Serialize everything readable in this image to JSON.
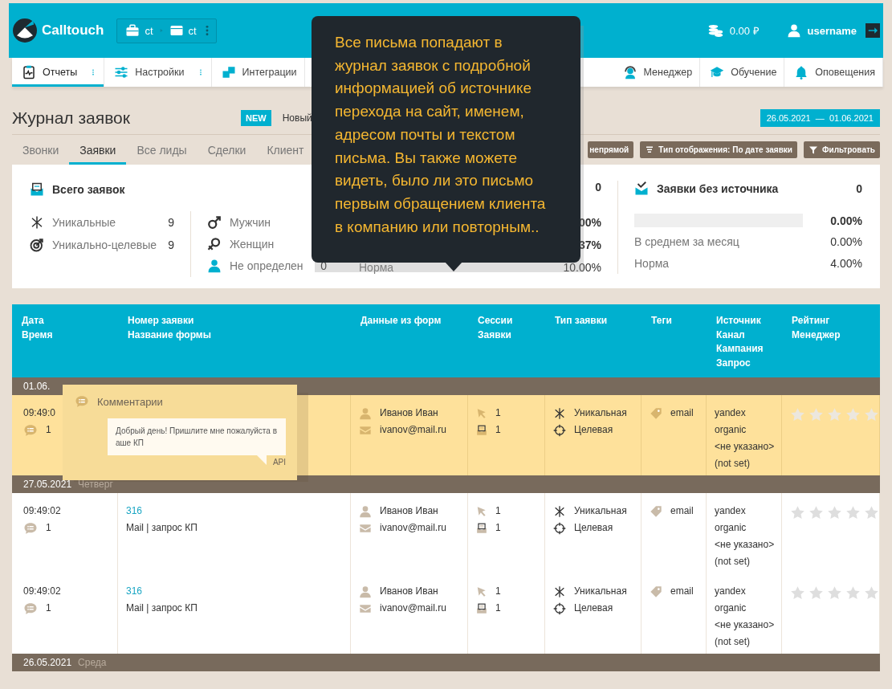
{
  "header": {
    "brand": "Calltouch",
    "breadcrumb": [
      "ct",
      "ct"
    ],
    "balance": "0.00 ₽",
    "user": "username"
  },
  "nav": [
    {
      "kind": "reports",
      "label": "Отчеты",
      "selected": true,
      "menu": true
    },
    {
      "kind": "settings",
      "label": "Настройки",
      "selected": false,
      "menu": true
    },
    {
      "kind": "integrations",
      "label": "Интеграции",
      "selected": false,
      "menu": false
    },
    {
      "kind": "manager",
      "label": "Менеджер",
      "selected": false,
      "menu": false
    },
    {
      "kind": "learning",
      "label": "Обучение",
      "selected": false,
      "menu": false
    },
    {
      "kind": "alerts",
      "label": "Оповещения",
      "selected": false,
      "menu": false
    }
  ],
  "page": {
    "title": "Журнал заявок",
    "badge": "NEW",
    "badge_text": "Новый",
    "date_range": "26.05.2021  —  01.06.2021"
  },
  "tabs": [
    {
      "label": "Звонки",
      "selected": false
    },
    {
      "label": "Заявки",
      "selected": true
    },
    {
      "label": "Все лиды",
      "selected": false
    },
    {
      "label": "Сделки",
      "selected": false
    },
    {
      "label": "Клиент",
      "selected": false
    }
  ],
  "toolbar_buttons": [
    {
      "kind": "plain",
      "label": "непрямой"
    },
    {
      "kind": "display",
      "label": "Тип отображения: По дате заявки"
    },
    {
      "kind": "filter",
      "label": "Фильтровать"
    }
  ],
  "stats": {
    "total": {
      "title": "Всего заявок",
      "rows": [
        {
          "kind": "unique",
          "label": "Уникальные",
          "value": "9"
        },
        {
          "kind": "target",
          "label": "Уникально-целевые",
          "value": "9"
        }
      ]
    },
    "gender": [
      {
        "kind": "male",
        "label": "Мужчин"
      },
      {
        "kind": "female",
        "label": "Женщин"
      },
      {
        "kind": "unknown",
        "label": "Не определен",
        "value": "0"
      }
    ],
    "middle": {
      "value": "0",
      "rows": [
        {
          "value": "00%"
        },
        {
          "value": "37%"
        },
        {
          "label": "Норма",
          "value": "10.00%"
        }
      ]
    },
    "no_source": {
      "title": "Заявки без источника",
      "value": "0",
      "level": 0,
      "percent": "0.00%",
      "rows": [
        {
          "label": "В среднем за месяц",
          "value": "0.00%"
        },
        {
          "label": "Норма",
          "value": "4.00%"
        }
      ]
    }
  },
  "table": {
    "columns": [
      {
        "lines": [
          "Дата",
          "Время"
        ]
      },
      {
        "lines": [
          "Номер заявки",
          "Название формы"
        ]
      },
      {
        "lines": [
          "Данные из форм"
        ]
      },
      {
        "lines": [
          "Сессии",
          "Заявки"
        ]
      },
      {
        "lines": [
          "Тип заявки"
        ]
      },
      {
        "lines": [
          "Теги"
        ]
      },
      {
        "lines": [
          "Источник",
          "Канал",
          "Кампания",
          "Запрос"
        ]
      },
      {
        "lines": [
          "Рейтинг",
          "Менеджер"
        ]
      }
    ],
    "groups": [
      {
        "date": "01.06.",
        "rows": [
          {
            "selected": true,
            "time": "09:49:0",
            "comments": "1",
            "name": "Иванов Иван",
            "email": "ivanov@mail.ru",
            "sessions": "1",
            "requests": "1",
            "types": [
              "Уникальная",
              "Целевая"
            ],
            "tag": "email",
            "source": [
              "yandex",
              "organic",
              "<не указано>",
              "(not set)"
            ],
            "stars": 0
          }
        ]
      },
      {
        "date": "27.05.2021",
        "weekday": "Четверг",
        "rows": [
          {
            "selected": false,
            "time": "09:49:02",
            "comments": "1",
            "number": "316",
            "form": "Mail | запрос КП",
            "name": "Иванов Иван",
            "email": "ivanov@mail.ru",
            "sessions": "1",
            "requests": "1",
            "types": [
              "Уникальная",
              "Целевая"
            ],
            "tag": "email",
            "source": [
              "yandex",
              "organic",
              "<не указано>",
              "(not set)"
            ],
            "stars": 0
          },
          {
            "selected": false,
            "time": "09:49:02",
            "comments": "1",
            "number": "316",
            "form": "Mail | запрос КП",
            "name": "Иванов Иван",
            "email": "ivanov@mail.ru",
            "sessions": "1",
            "requests": "1",
            "types": [
              "Уникальная",
              "Целевая"
            ],
            "tag": "email",
            "source": [
              "yandex",
              "organic",
              "<не указано>",
              "(not set)"
            ],
            "stars": 0
          }
        ]
      },
      {
        "date": "26.05.2021",
        "weekday": "Среда"
      }
    ]
  },
  "comment_popup": {
    "title": "Комментарии",
    "text": "Добрый день! Пришлите мне пожалуйста в аше КП",
    "source": "API"
  },
  "tooltip": {
    "text": "Все письма попадают в журнал заявок с подробной информацией об источнике перехода на сайт, именем, адресом почты и текстом письма. Вы также можете видеть, было ли это письмо первым обращением клиента в компанию или повторным.."
  }
}
